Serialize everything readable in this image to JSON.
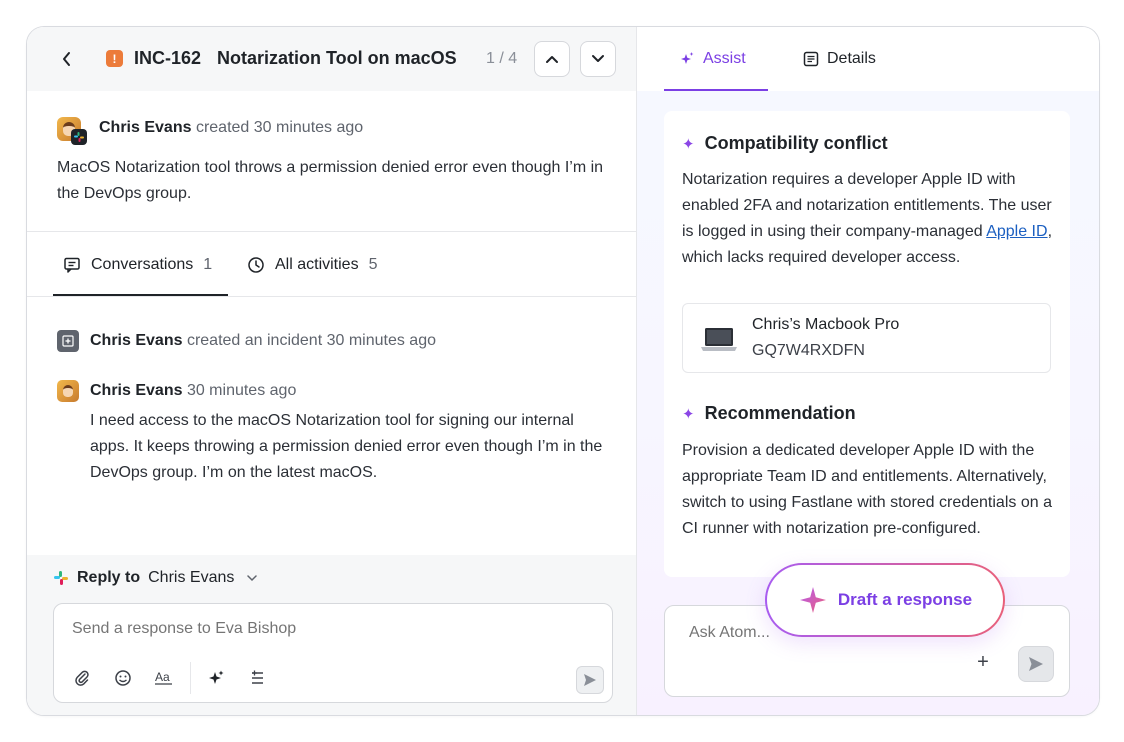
{
  "incident": {
    "id": "INC-162",
    "title": "Notarization Tool on macOS",
    "pager": "1 / 4",
    "severity_icon": "exclamation-icon"
  },
  "description": {
    "author": "Chris Evans",
    "action": "created",
    "time": "30 minutes ago",
    "body": "MacOS Notarization tool throws a permission denied error even though I’m in the DevOps group."
  },
  "tabs": [
    {
      "label": "Conversations",
      "count": "1",
      "icon": "chat-icon"
    },
    {
      "label": "All activities",
      "count": "5",
      "icon": "clock-icon"
    }
  ],
  "activities": [
    {
      "author": "Chris Evans",
      "action": "created an incident",
      "time": "30 minutes ago"
    },
    {
      "author": "Chris Evans",
      "time": "30 minutes ago",
      "body": "I need access to the macOS Notarization tool for signing our internal apps. It keeps throwing a permission denied error even though I’m in the DevOps group. I’m on the latest macOS."
    }
  ],
  "reply": {
    "prefix": "Reply to",
    "recipient": "Chris Evans",
    "placeholder": "Send a response to Eva Bishop"
  },
  "assist": {
    "tabs": [
      {
        "label": "Assist",
        "icon": "sparkle-icon"
      },
      {
        "label": "Details",
        "icon": "document-icon"
      }
    ],
    "sections": [
      {
        "title": "Compatibility conflict",
        "body_before_link": "Notarization requires a developer Apple ID with enabled 2FA and notarization entitlements. The user is logged in using their company-managed ",
        "link": "Apple ID",
        "body_after_link": ", which lacks required developer access."
      },
      {
        "title": "Recommendation",
        "body": "Provision a dedicated developer Apple ID with the appropriate Team ID and entitlements. Alternatively, switch to using Fastlane with stored credentials on a CI runner with notarization pre-configured."
      }
    ],
    "device": {
      "name": "Chris’s Macbook Pro",
      "serial": "GQ7W4RXDFN"
    },
    "ask_placeholder": "Ask Atom...",
    "draft_label": "Draft a response"
  },
  "colors": {
    "accent": "#7b3fe4",
    "severity": "#ec7b3a",
    "link": "#1b5fc1"
  }
}
